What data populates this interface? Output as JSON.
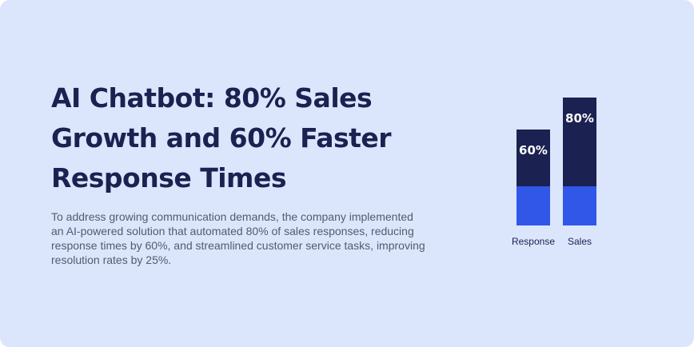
{
  "card": {
    "title": "AI Chatbot: 80% Sales Growth and 60% Faster Response Times",
    "description": "To address growing communication demands, the company implemented an AI-powered solution that automated 80% of sales responses, reducing response times by 60%, and streamlined customer service tasks, improving resolution rates by 25%."
  },
  "colors": {
    "background": "#dbe6fc",
    "bar_dark": "#1b2150",
    "bar_light": "#3057e8",
    "title": "#1b2150",
    "text": "#545b6b"
  },
  "chart_data": {
    "type": "bar",
    "categories": [
      "Response",
      "Sales"
    ],
    "values": [
      60,
      80
    ],
    "data_labels": [
      "60%",
      "80%"
    ],
    "ylim": [
      0,
      100
    ],
    "grid": false,
    "legend": "none"
  }
}
